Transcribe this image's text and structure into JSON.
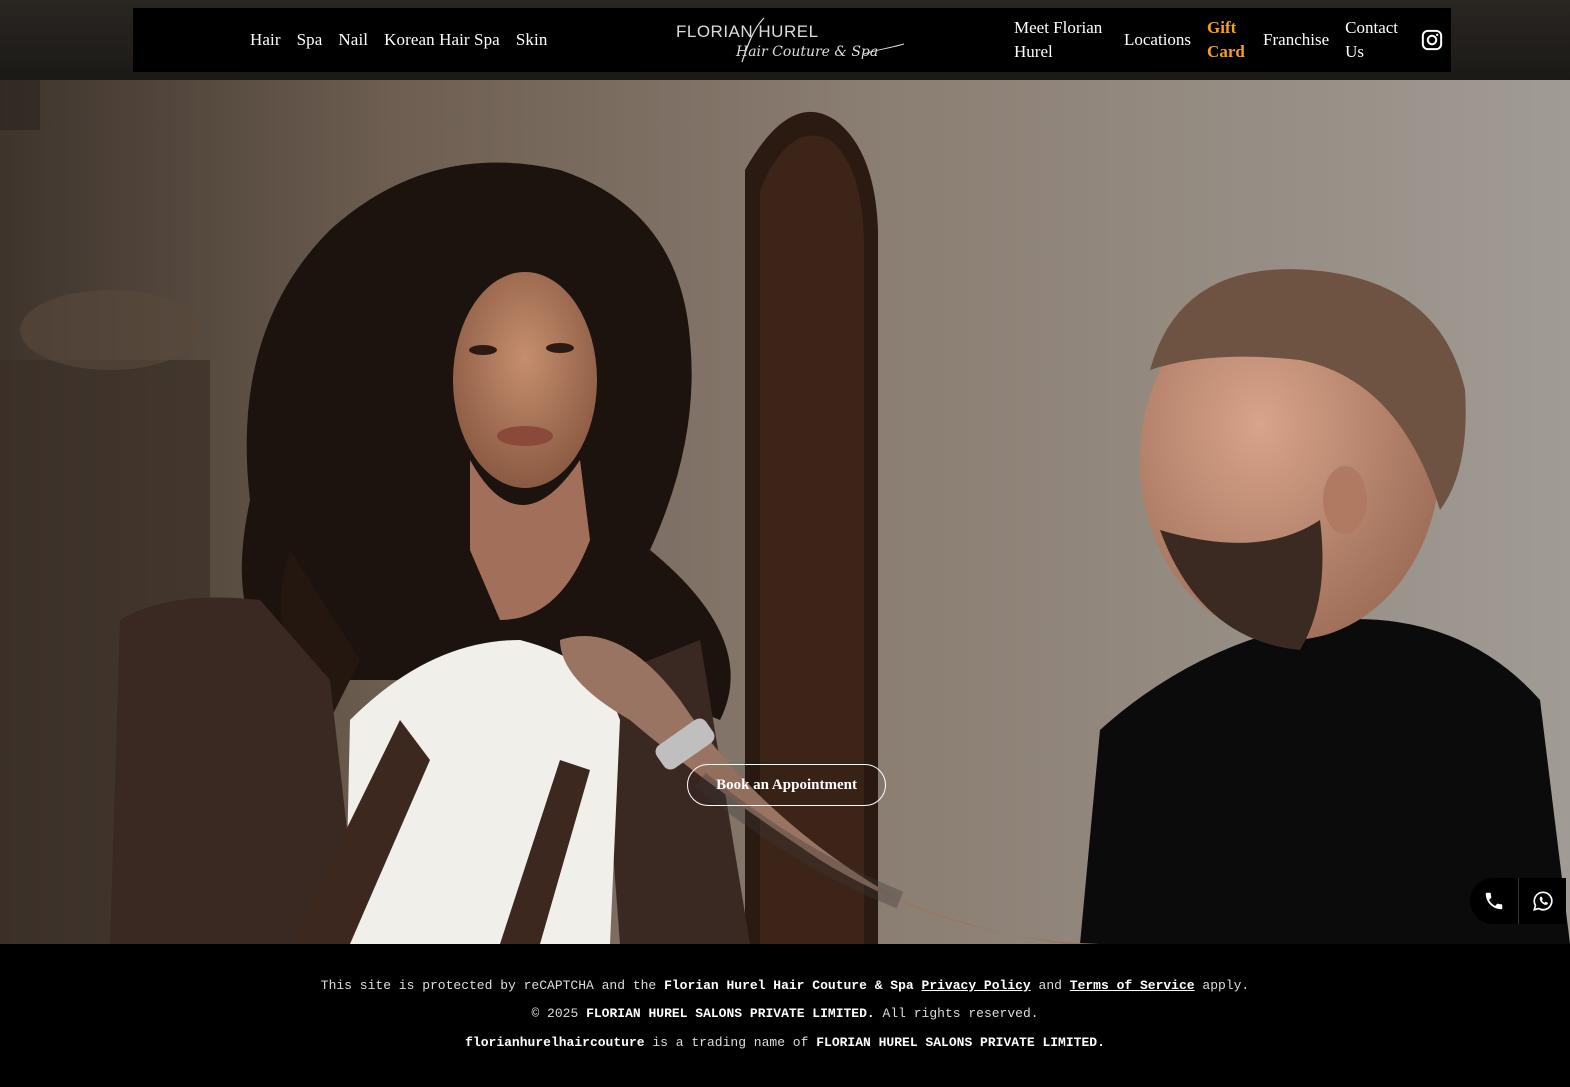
{
  "nav": {
    "left_items": [
      "Hair",
      "Spa",
      "Nail",
      "Korean Hair Spa",
      "Skin"
    ],
    "logo_text": "FLORIAN HUREL",
    "logo_script": "Hair Couture & Spa",
    "meet": "Meet Florian Hurel",
    "locations": "Locations",
    "gift": "Gift Card",
    "franchise": "Franchise",
    "contact": "Contact Us",
    "instagram_icon": "instagram-icon"
  },
  "hero": {
    "cta_label": "Book an Appointment"
  },
  "floating": {
    "phone_icon": "phone-icon",
    "whatsapp_icon": "whatsapp-icon"
  },
  "footer": {
    "l1_pre": "This site is protected by reCAPTCHA and the",
    "l1_brand": "Florian Hurel Hair Couture & Spa",
    "privacy": "Privacy Policy",
    "and": "and",
    "terms": "Terms of Service",
    "apply": "apply.",
    "l2_pre": "© 2025",
    "l2_company": "FLORIAN HUREL SALONS PRIVATE LIMITED.",
    "l2_post": "All rights reserved.",
    "l3_domain": "florianhurelhaircouture",
    "l3_mid": "is a trading name of",
    "l3_company": "FLORIAN HUREL SALONS PRIVATE LIMITED."
  },
  "colors": {
    "accent_gift": "#f6a11b",
    "nav_bg": "#000000",
    "footer_bg": "#000000"
  }
}
